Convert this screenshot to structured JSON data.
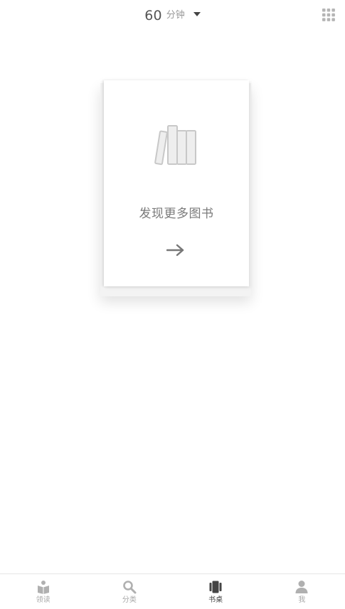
{
  "header": {
    "timer_value": "60",
    "timer_unit": "分钟"
  },
  "card": {
    "title": "发现更多图书"
  },
  "bottom_nav": {
    "items": [
      {
        "label": "领读",
        "icon": "reading-book-icon",
        "active": false
      },
      {
        "label": "分类",
        "icon": "search-icon",
        "active": false
      },
      {
        "label": "书桌",
        "icon": "bookshelf-icon",
        "active": true
      },
      {
        "label": "我",
        "icon": "person-icon",
        "active": false
      }
    ]
  },
  "colors": {
    "active": "#444444",
    "inactive": "#a8a8a8",
    "icon_gray": "#b0b0b0"
  }
}
